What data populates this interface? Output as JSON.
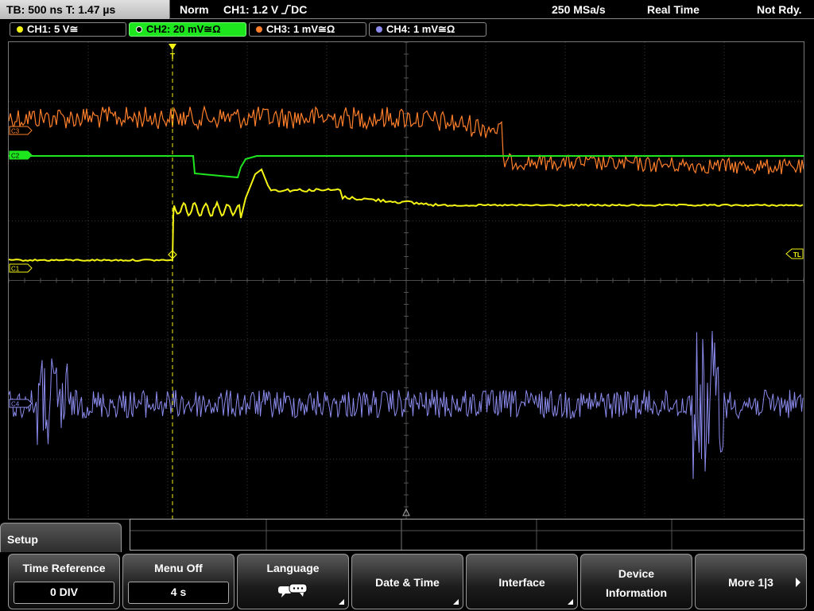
{
  "status_bar": {
    "timebase": "TB: 500 ns   T: 1.47 µs",
    "trigger_mode": "Norm",
    "trigger_info": "CH1: 1.2 V",
    "trigger_coupling": "DC",
    "sample_rate": "250 MSa/s",
    "acq_mode": "Real Time",
    "state": "Not Rdy."
  },
  "channels": [
    {
      "label": "CH1: 5 V",
      "coupling_sym": "≅",
      "color": "#f4f414"
    },
    {
      "label": "CH2: 20 mV",
      "coupling_sym": "≅Ω",
      "color": "#1ee61e"
    },
    {
      "label": "CH3: 1 mV",
      "coupling_sym": "≅Ω",
      "color": "#ff7f2a"
    },
    {
      "label": "CH4: 1 mV",
      "coupling_sym": "≅Ω",
      "color": "#8c8cf0"
    }
  ],
  "markers": {
    "trigger_level": "TL",
    "c1": "C1",
    "c2": "C2",
    "c3": "C3",
    "c4": "C4",
    "trigger_marker": "T"
  },
  "menu": {
    "title": "Setup",
    "time_reference": {
      "label": "Time Reference",
      "value": "0 DIV"
    },
    "menu_off": {
      "label": "Menu Off",
      "value": "4 s"
    },
    "language": {
      "label": "Language"
    },
    "date_time": {
      "label": "Date & Time"
    },
    "interface": {
      "label": "Interface"
    },
    "device_info": {
      "line1": "Device",
      "line2": "Information"
    },
    "more": {
      "label": "More 1|3"
    }
  },
  "icons": [
    "speech-bubble-icon",
    "right-arrow-icon",
    "submenu-arrow-icon",
    "trigger-marker-icon"
  ]
}
